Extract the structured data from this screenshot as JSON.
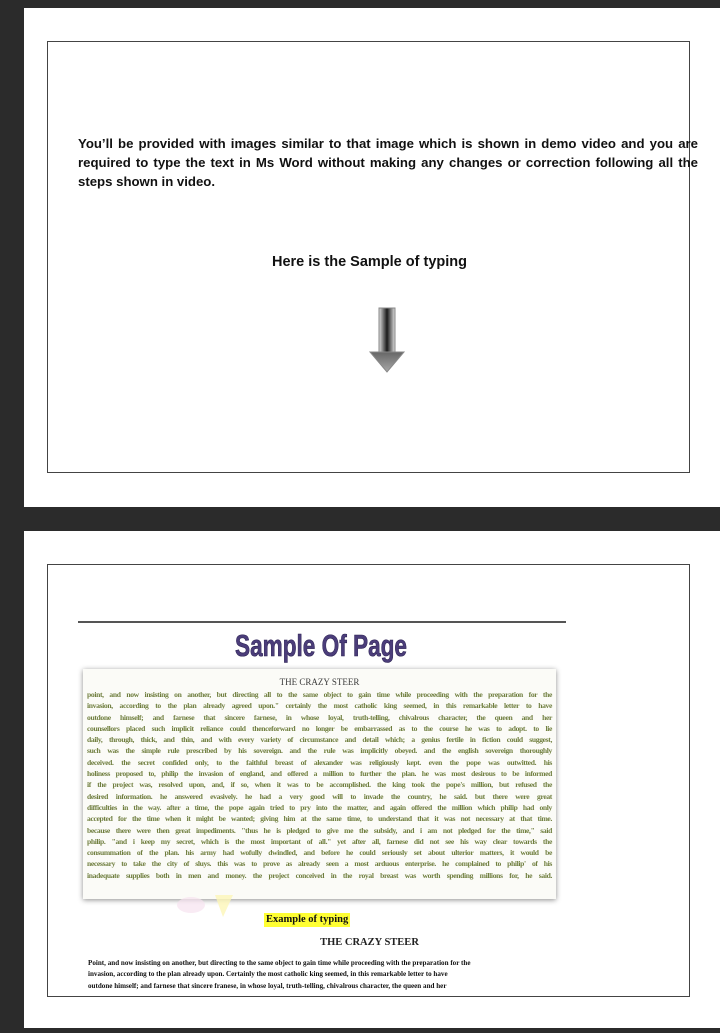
{
  "page1": {
    "instructions": "You’ll be provided with images similar to that image which is shown in demo video and you are required to type the text in Ms Word without making any changes or correction following all the steps shown in video.",
    "sample_heading": "Here is the Sample of typing",
    "arrow_icon": "down-arrow-icon"
  },
  "page2": {
    "title": "Sample Of Page",
    "title_color": "#4b3d7a",
    "scan": {
      "title": "THE CRAZY STEER",
      "text_color": "#6f7e3e",
      "lines": [
        "point, and now insisting on another, but directing all to the same object to gain time while proceeding with the preparation for the",
        "invasion, according to the plan already agreed upon.\" certainly the most catholic king seemed, in this remarkable letter to have",
        "outdone himself; and farnese that sincere farnese, in whose loyal, truth-telling, chivalrous character, the queen and her",
        "counsellors placed such implicit reliance could thenceforward no longer be embarrassed as to the course he was to adopt. to lie",
        "daily, through, thick, and thin, and with every variety of circumstance and detail which; a genius fertile in fiction could suggest,",
        "such was the simple rule prescribed by his sovereign. and the rule was implicitly obeyed. and the english sovereign thoroughly",
        "deceived. the secret confided only, to the faithful breast of alexander was religiously kept. even the pope was outwitted. his",
        "holiness proposed to, philip the invasion of england, and offered a million to further the plan. he was most desirous to be informed",
        "if the project was, resolved upon, and, if so, when it was to be accomplished. the king took the pope's million, but refused the",
        "desired information. he answered evasively. he had a very good will to invade the country, he said. but there were great",
        "difficulties in the way. after a time, the pope again tried to pry into the matter, and again offered the million which philip had only",
        "accepted for the time when it might be wanted; giving him at the same time, to understand that it was not necessary at that time.",
        "because there were then great impediments. \"thus he is pledged to give me the subsidy, and i am not pledged for the time,\" said",
        "philip. \"and i keep my secret, which is the most important of all.\" yet after all, farnese did not see his way clear towards the",
        "consummation of the plan. his army had wofully dwindled, and before he could seriously set about ulterior matters, it would be",
        "necessary to take the city of sluys. this was to prove as already seen a most arduous enterprise. he complained to philip' of his",
        "inadequate supplies both in men and money. the project conceived in the royal breast was worth spending millions for, he said."
      ]
    },
    "example_label": "Example of typing",
    "example_label_highlight": "#ffff33",
    "example_heading": "THE CRAZY STEER",
    "typed_lines": [
      "Point, and now insisting on another, but directing to the same object to gain time while proceeding with the preparation for the",
      "invasion, according to the plan already upon. Certainly the most catholic king seemed, in this remarkable letter to have",
      "outdone himself; and farnese that sincere franese, in whose loyal, truth-telling, chivalrous character, the queen and her"
    ]
  }
}
